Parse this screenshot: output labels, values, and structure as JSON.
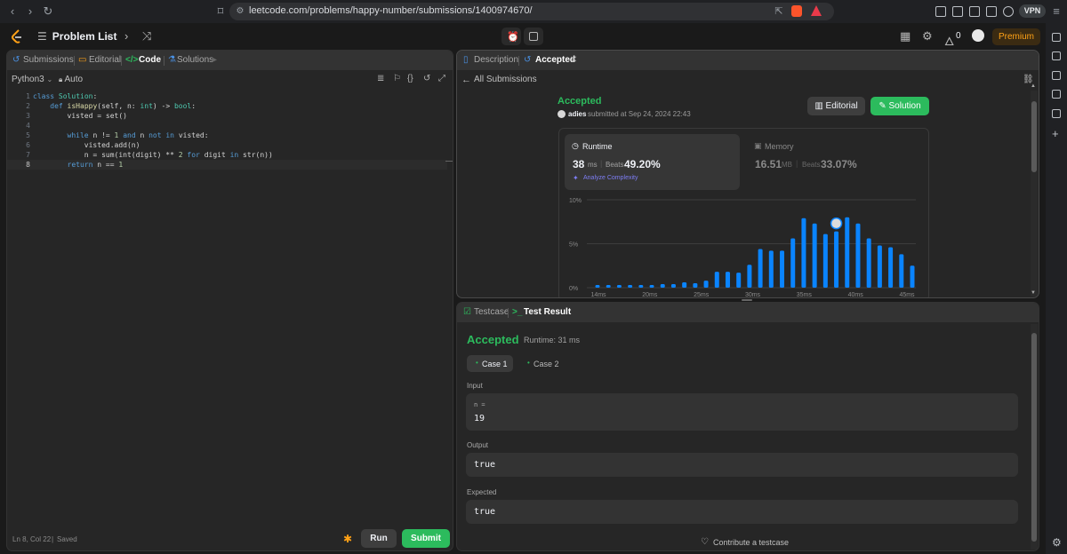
{
  "browser": {
    "url": "leetcode.com/problems/happy-number/submissions/1400974670/",
    "vpn_label": "VPN"
  },
  "topbar": {
    "problem_list_label": "Problem List",
    "streak_count": "0",
    "premium_label": "Premium"
  },
  "left_panel": {
    "tabs": [
      {
        "label": "Submissions",
        "active": false
      },
      {
        "label": "Editorial",
        "active": false
      },
      {
        "label": "Code",
        "active": true
      },
      {
        "label": "Solutions",
        "active": false
      }
    ],
    "language": "Python3",
    "auto_label": "Auto",
    "code_lines": [
      "class Solution:",
      "    def isHappy(self, n: int) -> bool:",
      "        visted = set()",
      "",
      "        while n != 1 and n not in visted:",
      "            visted.add(n)",
      "            n = sum(int(digit) ** 2 for digit in str(n))",
      "        return n == 1"
    ],
    "status_position": "Ln 8, Col 22",
    "status_saved": "Saved",
    "run_label": "Run",
    "submit_label": "Submit"
  },
  "right_top": {
    "tabs": [
      {
        "label": "Description",
        "active": false
      },
      {
        "label": "Accepted",
        "active": true
      }
    ],
    "all_submissions_label": "All Submissions",
    "status": "Accepted",
    "user": "adies",
    "submitted_text": "submitted at Sep 24, 2024 22:43",
    "editorial_btn": "Editorial",
    "solution_btn": "Solution",
    "runtime": {
      "label": "Runtime",
      "value": "38",
      "unit": "ms",
      "beats_label": "Beats",
      "beats_value": "49.20%",
      "analyze_label": "Analyze Complexity"
    },
    "memory": {
      "label": "Memory",
      "value": "16.51",
      "unit": "MB",
      "beats_label": "Beats",
      "beats_value": "33.07%"
    }
  },
  "chart_data": {
    "type": "bar",
    "y_ticks": [
      "10%",
      "5%",
      "0%"
    ],
    "ylim": [
      0,
      10
    ],
    "x_ticks": [
      "14ms",
      "20ms",
      "25ms",
      "30ms",
      "35ms",
      "40ms",
      "45ms"
    ],
    "values": [
      0.3,
      0.3,
      0.3,
      0.3,
      0.3,
      0.3,
      0.4,
      0.4,
      0.6,
      0.5,
      0.8,
      1.8,
      1.8,
      1.7,
      2.6,
      4.4,
      4.2,
      4.2,
      5.6,
      7.9,
      7.3,
      6.1,
      6.4,
      8.0,
      7.3,
      5.6,
      4.8,
      4.6,
      3.8,
      2.5
    ],
    "highlight_index": 22,
    "bar_color": "#0a84ff"
  },
  "right_bottom": {
    "tabs": [
      {
        "label": "Testcase",
        "active": false
      },
      {
        "label": "Test Result",
        "active": true
      }
    ],
    "result_status": "Accepted",
    "runtime_text": "Runtime: 31 ms",
    "cases": [
      {
        "label": "Case 1",
        "active": true
      },
      {
        "label": "Case 2",
        "active": false
      }
    ],
    "input_label": "Input",
    "input_var": "n =",
    "input_value": "19",
    "output_label": "Output",
    "output_value": "true",
    "expected_label": "Expected",
    "expected_value": "true",
    "contribute_label": "Contribute a testcase"
  },
  "colors": {
    "accent_green": "#2cbb5d",
    "accent_orange": "#ffa116",
    "bar_blue": "#0a84ff"
  }
}
